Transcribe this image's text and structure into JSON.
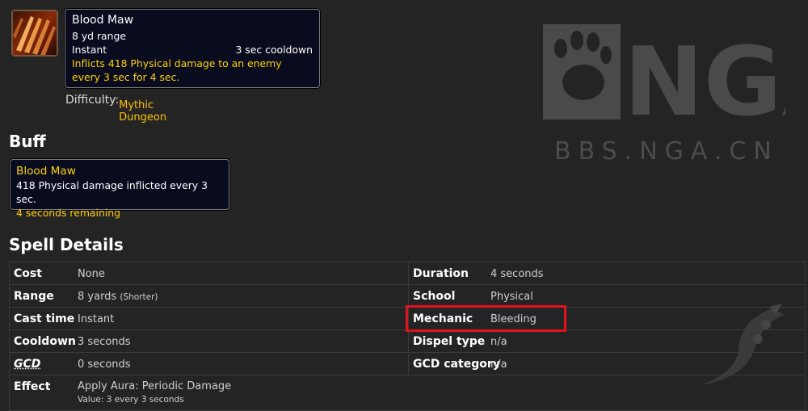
{
  "spell": {
    "icon": "blood-claw-icon",
    "name": "Blood Maw",
    "range": "8 yd range",
    "cast": "Instant",
    "cooldown": "3 sec cooldown",
    "description": "Inflicts 418 Physical damage to an enemy every 3 sec for 4 sec."
  },
  "difficulty": {
    "label": "Difficulty: ",
    "value": "Mythic Dungeon"
  },
  "buff": {
    "heading": "Buff",
    "name": "Blood Maw",
    "line1": "418 Physical damage inflicted every 3 sec.",
    "line2": "4 seconds remaining"
  },
  "details": {
    "heading": "Spell Details",
    "left": [
      {
        "label": "Cost",
        "value": "None"
      },
      {
        "label": "Range",
        "value": "8 yards",
        "note": "(Shorter)"
      },
      {
        "label": "Cast time",
        "value": "Instant"
      },
      {
        "label": "Cooldown",
        "value": "3 seconds"
      },
      {
        "label": "GCD",
        "value": "0 seconds"
      }
    ],
    "right": [
      {
        "label": "Duration",
        "value": "4 seconds"
      },
      {
        "label": "School",
        "value": "Physical"
      },
      {
        "label": "Mechanic",
        "value": "Bleeding"
      },
      {
        "label": "Dispel type",
        "value": "n/a"
      },
      {
        "label": "GCD category",
        "value": "n/a"
      }
    ],
    "effect": {
      "label": "Effect",
      "value": "Apply Aura: Periodic Damage",
      "sub": "Value: 3 every 3 seconds"
    }
  },
  "watermark": {
    "logo": "NGA",
    "site": "BBS.NGA.CN"
  },
  "colors": {
    "background": "#242424",
    "tooltip_bg": "#080c1e",
    "yellow": "#ffd100",
    "highlight": "#e0121e"
  }
}
